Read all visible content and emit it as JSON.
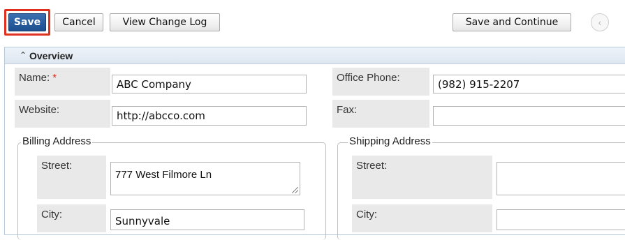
{
  "toolbar": {
    "save_label": "Save",
    "cancel_label": "Cancel",
    "change_log_label": "View Change Log",
    "save_continue_label": "Save and Continue",
    "prev_icon": "chevron-left-icon"
  },
  "panel": {
    "collapse_icon": "⌃",
    "title": "Overview"
  },
  "fields": {
    "name": {
      "label": "Name:",
      "required_marker": "*",
      "value": "ABC Company"
    },
    "office_phone": {
      "label": "Office Phone:",
      "value": "(982) 915-2207"
    },
    "website": {
      "label": "Website:",
      "value": "http://abcco.com"
    },
    "fax": {
      "label": "Fax:",
      "value": ""
    }
  },
  "billing": {
    "legend": "Billing Address",
    "street_label": "Street:",
    "street_value": "777 West Filmore Ln",
    "city_label": "City:",
    "city_value": "Sunnyvale"
  },
  "shipping": {
    "legend": "Shipping Address",
    "street_label": "Street:",
    "street_value": "",
    "city_label": "City:",
    "city_value": ""
  },
  "colors": {
    "save_button": "#1d4f8f",
    "highlight": "#e0301e",
    "panel_header": "#dde6f0",
    "label_bg": "#e9e9e9"
  }
}
